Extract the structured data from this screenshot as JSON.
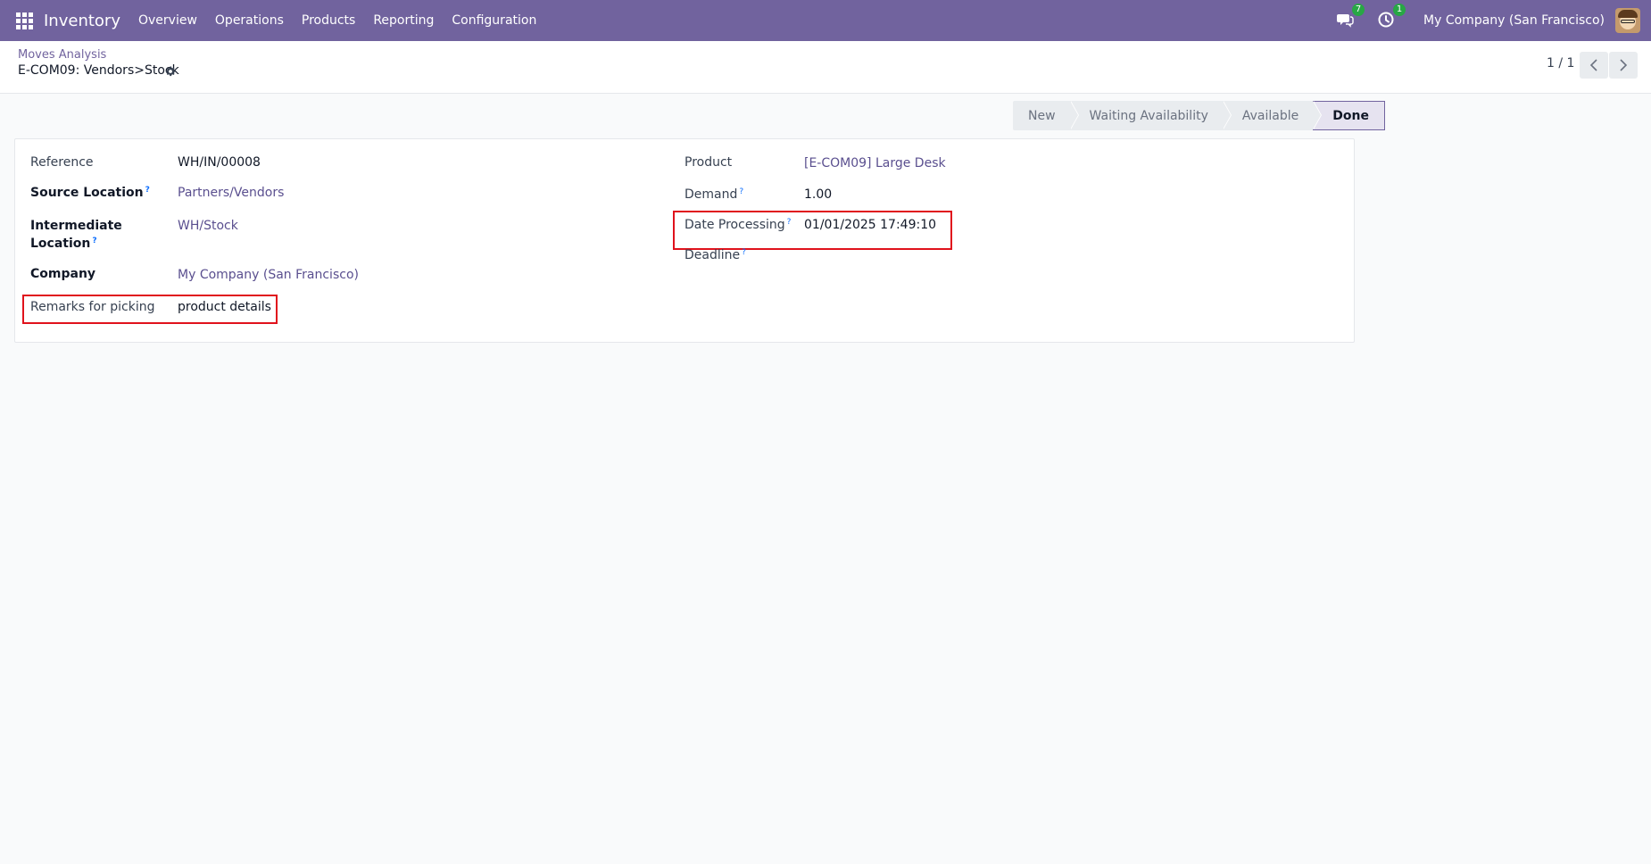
{
  "navbar": {
    "app_name": "Inventory",
    "menu": [
      "Overview",
      "Operations",
      "Products",
      "Reporting",
      "Configuration"
    ],
    "messages_badge": "7",
    "activities_badge": "1",
    "company": "My Company (San Francisco)"
  },
  "breadcrumb": {
    "parent": "Moves Analysis",
    "current": "E-COM09: Vendors>Stock"
  },
  "pager": {
    "value": "1 / 1"
  },
  "statusbar": {
    "stages": [
      "New",
      "Waiting Availability",
      "Available",
      "Done"
    ],
    "active": "Done"
  },
  "form": {
    "reference_label": "Reference",
    "reference_value": "WH/IN/00008",
    "source_location_label": "Source Location",
    "source_location_value": "Partners/Vendors",
    "intermediate_location_label_1": "Intermediate",
    "intermediate_location_label_2": "Location",
    "intermediate_location_value": "WH/Stock",
    "company_label": "Company",
    "company_value": "My Company (San Francisco)",
    "remarks_label": "Remarks for picking",
    "remarks_value": "product details",
    "product_label": "Product",
    "product_value": "[E-COM09] Large Desk",
    "demand_label": "Demand",
    "demand_value": "1.00",
    "date_processing_label": "Date Processing",
    "date_processing_value": "01/01/2025 17:49:10",
    "deadline_label": "Deadline",
    "help_mark": "?"
  },
  "colors": {
    "navbar": "#71639e",
    "highlight": "#e0121c",
    "link": "#5a4f8f",
    "badge": "#28a745"
  }
}
